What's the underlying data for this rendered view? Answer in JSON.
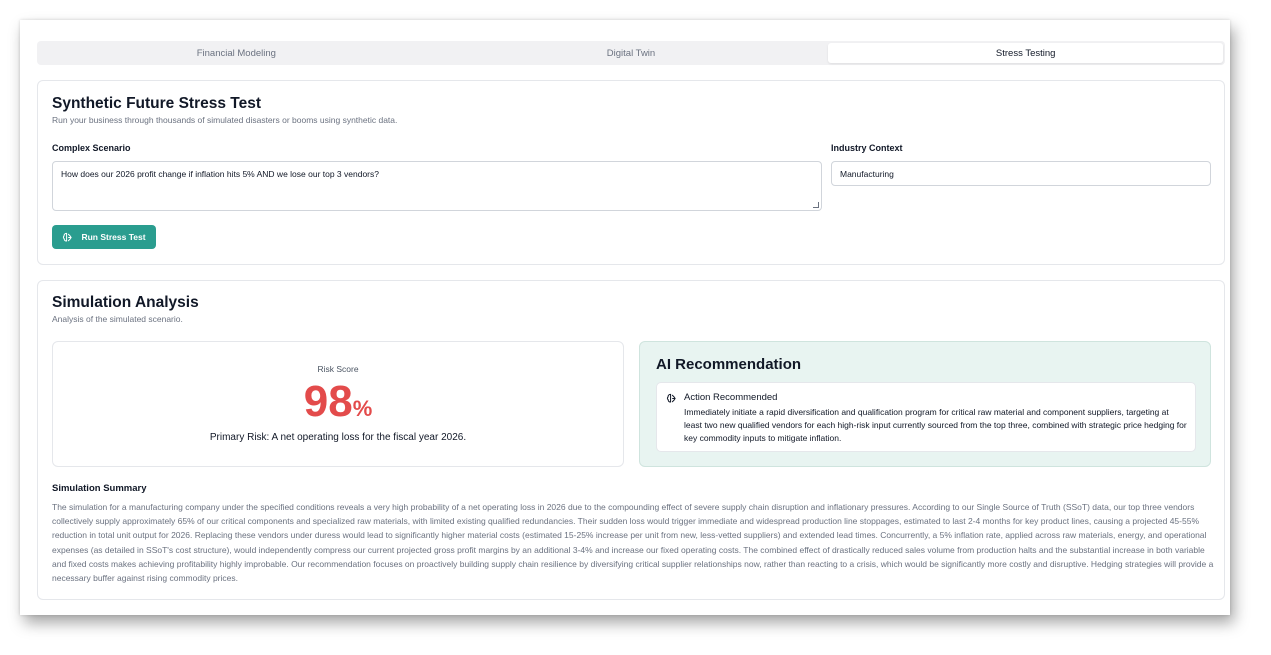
{
  "tabs": [
    {
      "label": "Financial Modeling",
      "active": false
    },
    {
      "label": "Digital Twin",
      "active": false
    },
    {
      "label": "Stress Testing",
      "active": true
    }
  ],
  "stress_test": {
    "title": "Synthetic Future Stress Test",
    "description": "Run your business through thousands of simulated disasters or booms using synthetic data.",
    "scenario_label": "Complex Scenario",
    "scenario_value": "How does our 2026 profit change if inflation hits 5% AND we lose our top 3 vendors?",
    "industry_label": "Industry Context",
    "industry_value": "Manufacturing",
    "run_button_label": "Run Stress Test",
    "button_icon": "brain-icon"
  },
  "analysis": {
    "title": "Simulation Analysis",
    "description": "Analysis of the simulated scenario.",
    "risk_label": "Risk Score",
    "risk_value": "98",
    "risk_unit": "%",
    "primary_risk": "Primary Risk: A net operating loss for the fiscal year 2026.",
    "ai_title": "AI Recommendation",
    "action_title": "Action Recommended",
    "action_text": "Immediately initiate a rapid diversification and qualification program for critical raw material and component suppliers, targeting at least two new qualified vendors for each high-risk input currently sourced from the top three, combined with strategic price hedging for key commodity inputs to mitigate inflation.",
    "summary_title": "Simulation Summary",
    "summary_text": "The simulation for a manufacturing company under the specified conditions reveals a very high probability of a net operating loss in 2026 due to the compounding effect of severe supply chain disruption and inflationary pressures. According to our Single Source of Truth (SSoT) data, our top three vendors collectively supply approximately 65% of our critical components and specialized raw materials, with limited existing qualified redundancies. Their sudden loss would trigger immediate and widespread production line stoppages, estimated to last 2-4 months for key product lines, causing a projected 45-55% reduction in total unit output for 2026. Replacing these vendors under duress would lead to significantly higher material costs (estimated 15-25% increase per unit from new, less-vetted suppliers) and extended lead times. Concurrently, a 5% inflation rate, applied across raw materials, energy, and operational expenses (as detailed in SSoT's cost structure), would independently compress our current projected gross profit margins by an additional 3-4% and increase our fixed operating costs. The combined effect of drastically reduced sales volume from production halts and the substantial increase in both variable and fixed costs makes achieving profitability highly improbable. Our recommendation focuses on proactively building supply chain resilience by diversifying critical supplier relationships now, rather than reacting to a crisis, which would be significantly more costly and disruptive. Hedging strategies will provide a necessary buffer against rising commodity prices."
  },
  "colors": {
    "accent": "#2a9d8f",
    "risk": "#e34b4b",
    "recommendation_bg": "#e8f4f1"
  }
}
